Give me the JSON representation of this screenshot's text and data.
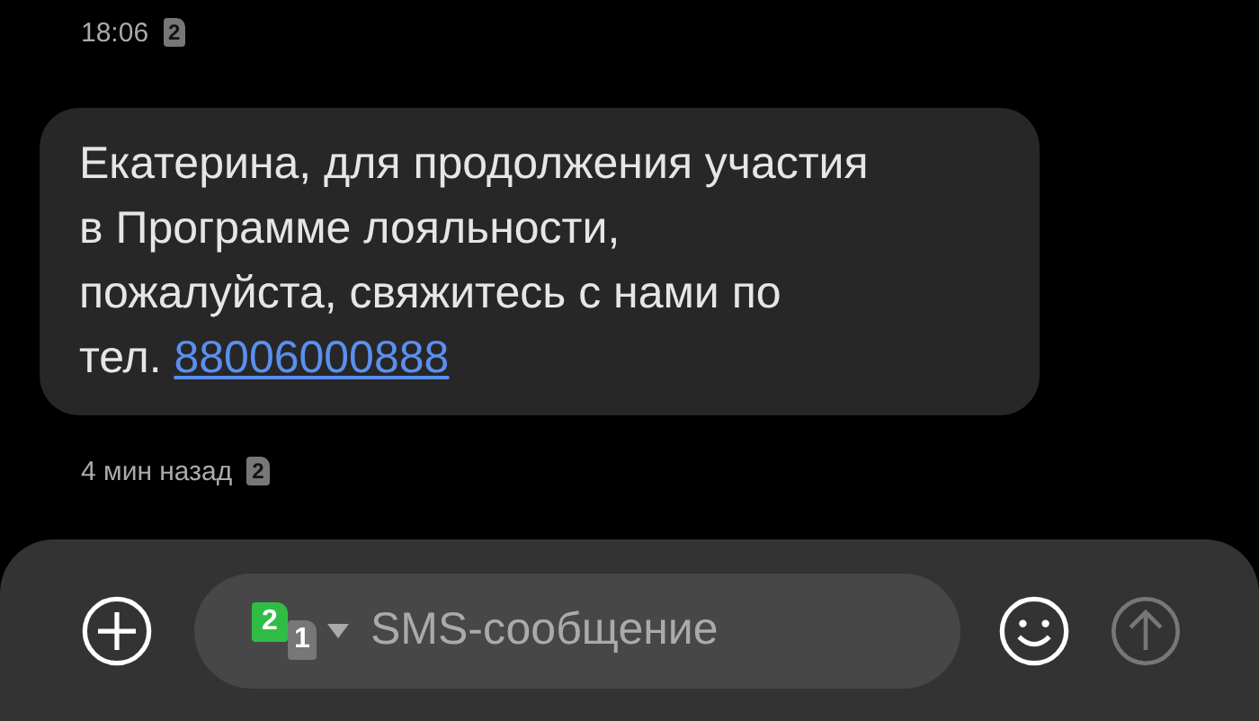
{
  "header": {
    "time": "18:06",
    "sim": "2"
  },
  "message": {
    "text": "Екатерина, для продолжения участия в Программе лояльности, пожалуйста, свяжитесь с нами по тел.",
    "link": "88006000888"
  },
  "meta": {
    "time": "4 мин назад",
    "sim": "2"
  },
  "compose": {
    "sims": [
      {
        "label": "2",
        "selected": true
      },
      {
        "label": "1",
        "selected": false
      }
    ],
    "placeholder": "SMS-сообщение",
    "send_disabled": true
  }
}
